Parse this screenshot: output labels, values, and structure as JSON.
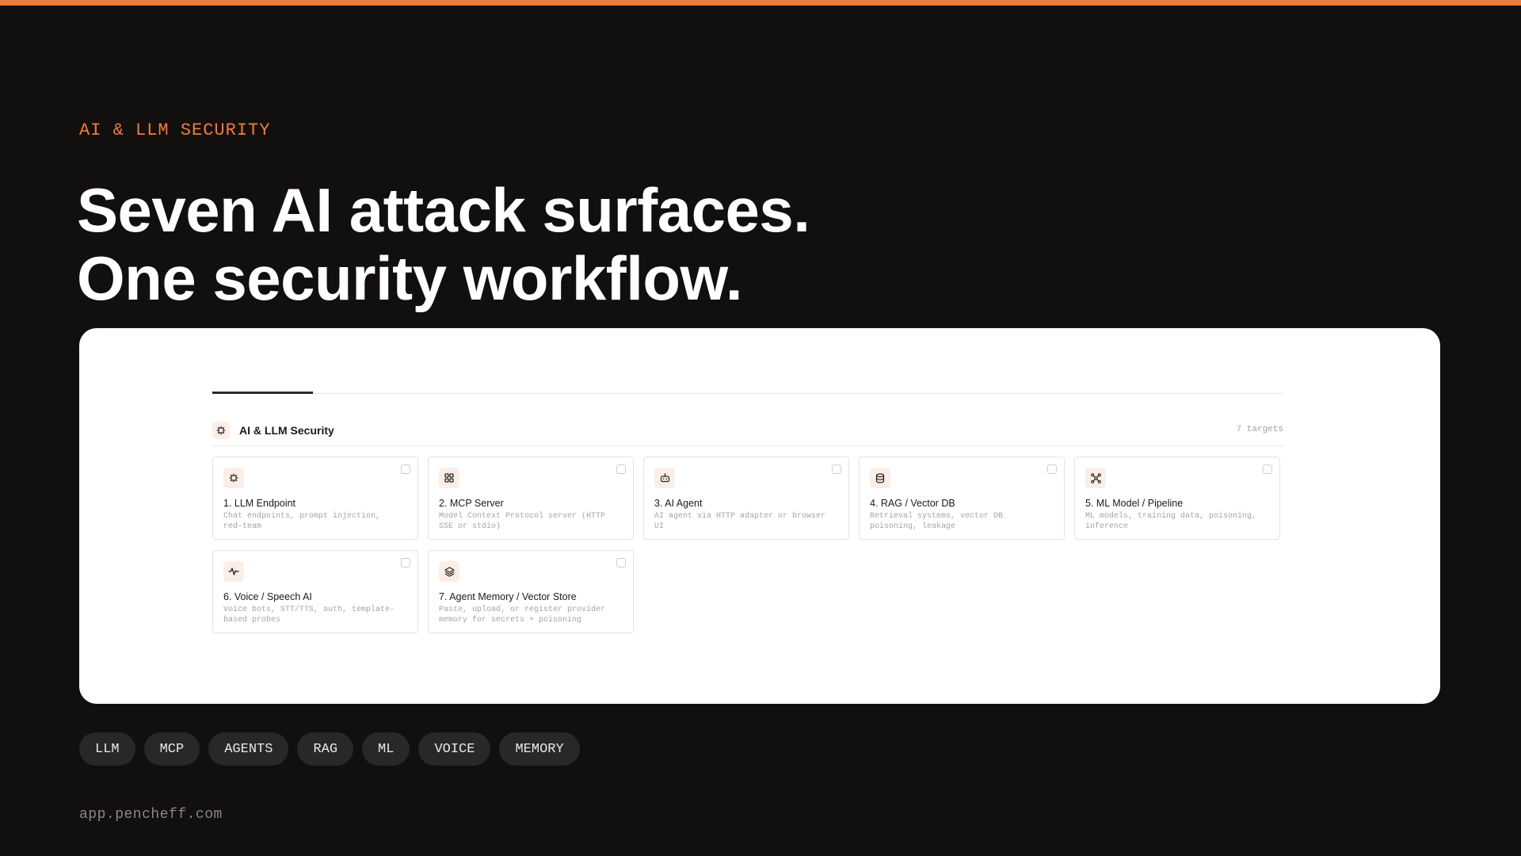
{
  "colors": {
    "background": "#12100f",
    "accent": "#ee7b42",
    "panel": "#ffffff",
    "tag_bg": "#2a2827"
  },
  "eyebrow": "AI & LLM SECURITY",
  "headline": {
    "line1": "Seven AI attack surfaces.",
    "line2": "One security workflow."
  },
  "panel": {
    "section": {
      "icon": "chip-icon",
      "title": "AI & LLM Security",
      "count": "7 targets"
    },
    "cards": [
      {
        "icon": "chip-icon",
        "title": "1. LLM Endpoint",
        "description": "Chat endpoints, prompt injection, red-team"
      },
      {
        "icon": "grid-icon",
        "title": "2. MCP Server",
        "description": "Model Context Protocol server (HTTP SSE or stdio)"
      },
      {
        "icon": "robot-icon",
        "title": "3. AI Agent",
        "description": "AI agent via HTTP adapter or browser UI"
      },
      {
        "icon": "database-icon",
        "title": "4. RAG / Vector DB",
        "description": "Retrieval systems, vector DB poisoning, leakage"
      },
      {
        "icon": "network-icon",
        "title": "5. ML Model / Pipeline",
        "description": "ML models, training data, poisoning, inference"
      },
      {
        "icon": "waveform-icon",
        "title": "6. Voice / Speech AI",
        "description": "Voice bots, STT/TTS, auth, template-based probes"
      },
      {
        "icon": "layers-icon",
        "title": "7. Agent Memory / Vector Store",
        "description": "Paste, upload, or register provider memory for secrets + poisoning"
      }
    ]
  },
  "tags": [
    "LLM",
    "MCP",
    "AGENTS",
    "RAG",
    "ML",
    "VOICE",
    "MEMORY"
  ],
  "footer_url": "app.pencheff.com"
}
